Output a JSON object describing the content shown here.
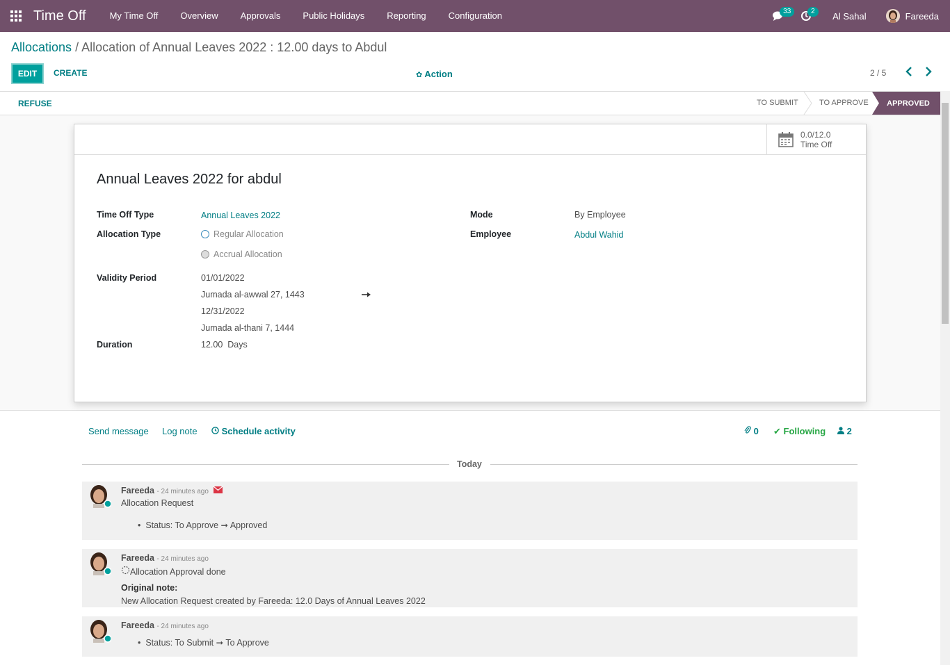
{
  "navbar": {
    "app_title": "Time Off",
    "menu": [
      "My Time Off",
      "Overview",
      "Approvals",
      "Public Holidays",
      "Reporting",
      "Configuration"
    ],
    "messages_count": "33",
    "activities_count": "2",
    "company": "Al Sahal",
    "user": "Fareeda"
  },
  "breadcrumb": {
    "parent": "Allocations",
    "separator": "/",
    "current": "Allocation of Annual Leaves 2022 : 12.00 days to Abdul"
  },
  "control": {
    "edit": "EDIT",
    "create": "CREATE",
    "action": "Action",
    "pager": "2 / 5"
  },
  "statusbar": {
    "refuse": "REFUSE",
    "stages": [
      "TO SUBMIT",
      "TO APPROVE",
      "APPROVED"
    ],
    "active_stage": "APPROVED"
  },
  "form": {
    "stat": {
      "value": "0.0/12.0",
      "label": "Time Off"
    },
    "title": "Annual Leaves 2022 for abdul",
    "time_off_type_label": "Time Off Type",
    "time_off_type": "Annual Leaves 2022",
    "allocation_type_label": "Allocation Type",
    "allocation_options": [
      "Regular Allocation",
      "Accrual Allocation"
    ],
    "validity_label": "Validity Period",
    "date_from": "01/01/2022",
    "date_from_hijri": "Jumada al-awwal 27, 1443",
    "date_to": "12/31/2022",
    "date_to_hijri": "Jumada al-thani 7, 1444",
    "duration_label": "Duration",
    "duration_value": "12.00",
    "duration_unit": "Days",
    "mode_label": "Mode",
    "mode": "By Employee",
    "employee_label": "Employee",
    "employee": "Abdul Wahid"
  },
  "chatter": {
    "send_message": "Send message",
    "log_note": "Log note",
    "schedule_activity": "Schedule activity",
    "attachments": "0",
    "following": "Following",
    "followers": "2",
    "today": "Today",
    "messages": [
      {
        "author": "Fareeda",
        "time": "- 24 minutes ago",
        "subject": "Allocation Request",
        "tracking_label": "Status:",
        "from": "To Approve",
        "to": "Approved"
      },
      {
        "author": "Fareeda",
        "time": "- 24 minutes ago",
        "subject": "Allocation Approval done",
        "note_label": "Original note:",
        "note": "New Allocation Request created by Fareeda: 12.0 Days of Annual Leaves 2022"
      },
      {
        "author": "Fareeda",
        "time": "- 24 minutes ago",
        "tracking_label": "Status:",
        "from": "To Submit",
        "to": "To Approve"
      }
    ]
  },
  "colors": {
    "navbar": "#71506a",
    "primary": "#00a09d",
    "link": "#017e84"
  }
}
